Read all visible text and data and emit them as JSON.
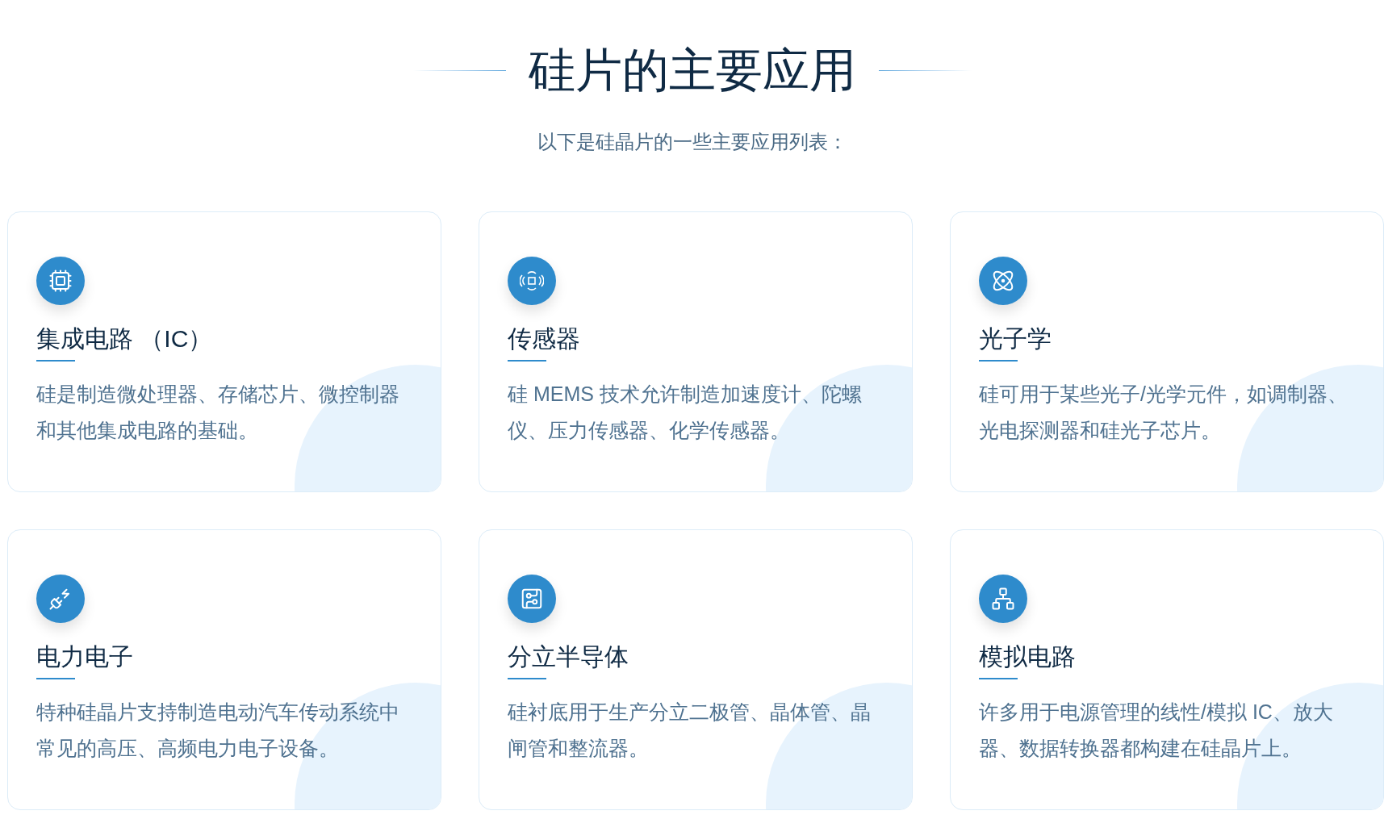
{
  "title": "硅片的主要应用",
  "subtitle": "以下是硅晶片的一些主要应用列表：",
  "cards": [
    {
      "kind": "chip",
      "heading": "集成电路 （IC）",
      "text": "硅是制造微处理器、存储芯片、微控制器和其他集成电路的基础。"
    },
    {
      "kind": "sensor",
      "heading": "传感器",
      "text": "硅 MEMS 技术允许制造加速度计、陀螺仪、压力传感器、化学传感器。"
    },
    {
      "kind": "photonics",
      "heading": "光子学",
      "text": "硅可用于某些光子/光学元件，如调制器、光电探测器和硅光子芯片。"
    },
    {
      "kind": "power",
      "heading": "电力电子",
      "text": "特种硅晶片支持制造电动汽车传动系统中常见的高压、高频电力电子设备。"
    },
    {
      "kind": "discrete",
      "heading": "分立半导体",
      "text": "硅衬底用于生产分立二极管、晶体管、晶闸管和整流器。"
    },
    {
      "kind": "analog",
      "heading": "模拟电路",
      "text": "许多用于电源管理的线性/模拟 IC、放大器、数据转换器都构建在硅晶片上。"
    }
  ]
}
